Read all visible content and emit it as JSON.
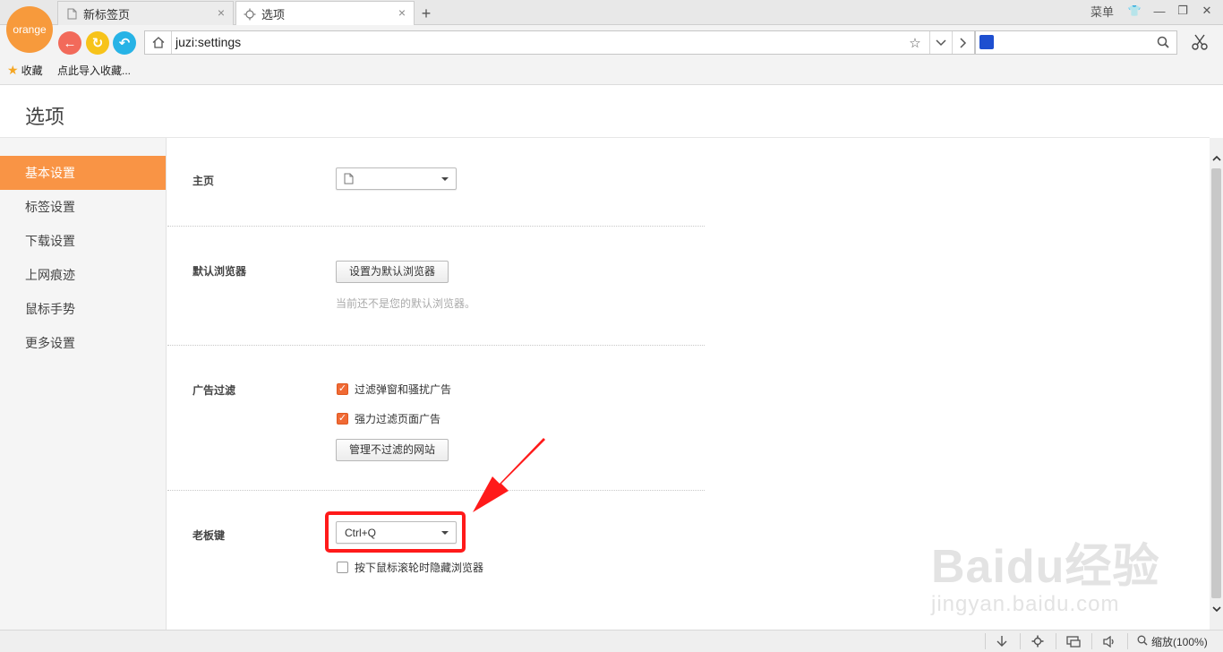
{
  "browser": {
    "logo_text": "orange",
    "tabs": [
      {
        "label": "新标签页",
        "close": "×"
      },
      {
        "label": "选项",
        "close": "×"
      }
    ],
    "new_tab": "+",
    "window_controls": {
      "menu": "菜单",
      "skin": "👕",
      "minimize": "—",
      "restore": "❐",
      "close": "✕"
    },
    "nav": {
      "back": "←",
      "refresh": "↻",
      "undo": "↶"
    },
    "address": "juzi:settings",
    "address_buttons": {
      "favorite": "☆",
      "dropdown": "⌄",
      "forward": ">"
    },
    "search": {
      "value": "",
      "icon": "search-icon"
    },
    "bookmarks": [
      {
        "label": "收藏"
      },
      {
        "label": "点此导入收藏..."
      }
    ]
  },
  "page": {
    "title": "选项",
    "sidebar": [
      {
        "label": "基本设置",
        "active": true
      },
      {
        "label": "标签设置"
      },
      {
        "label": "下载设置"
      },
      {
        "label": "上网痕迹"
      },
      {
        "label": "鼠标手势"
      },
      {
        "label": "更多设置"
      }
    ],
    "settings": {
      "homepage": {
        "label": "主页",
        "value": ""
      },
      "default_browser": {
        "label": "默认浏览器",
        "button": "设置为默认浏览器",
        "hint": "当前还不是您的默认浏览器。"
      },
      "ad_filter": {
        "label": "广告过滤",
        "options": [
          {
            "label": "过滤弹窗和骚扰广告",
            "checked": true
          },
          {
            "label": "强力过滤页面广告",
            "checked": true
          }
        ],
        "button": "管理不过滤的网站"
      },
      "boss_key": {
        "label": "老板键",
        "value": "Ctrl+Q",
        "option": {
          "label": "按下鼠标滚轮时隐藏浏览器",
          "checked": false
        }
      }
    }
  },
  "statusbar": {
    "zoom": "缩放(100%)"
  },
  "watermark": {
    "text": "Baidu经验",
    "sub": "jingyan.baidu.com"
  },
  "colors": {
    "accent": "#f99445",
    "highlight": "#ff1a1a",
    "checkbox": "#f06a35"
  }
}
